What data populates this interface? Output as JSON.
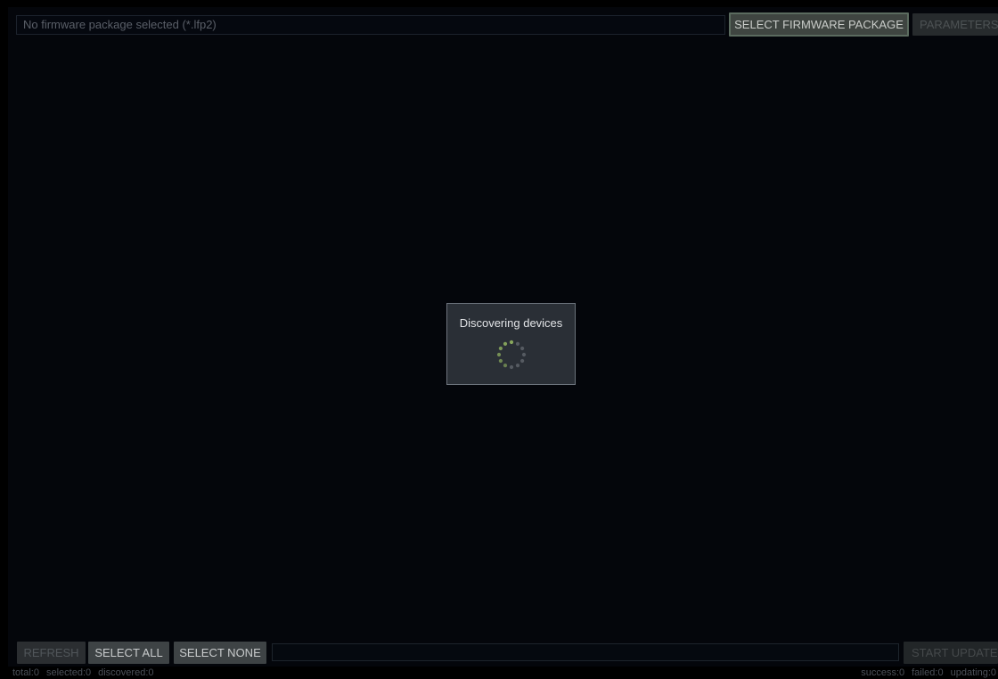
{
  "toolbar": {
    "firmware_field_text": "No firmware package selected (*.lfp2)",
    "select_firmware_label": "SELECT FIRMWARE PACKAGE",
    "parameters_label": "PARAMETERS"
  },
  "bottom_bar": {
    "refresh_label": "REFRESH",
    "select_all_label": "SELECT ALL",
    "select_none_label": "SELECT NONE",
    "start_update_label": "START UPDATE",
    "progress": 0
  },
  "status": {
    "total": "total:0",
    "selected": "selected:0",
    "discovered": "discovered:0",
    "success": "success:0",
    "failed": "failed:0",
    "updating": "updating:0"
  },
  "dialog": {
    "title": "Discovering devices",
    "spinner_icon": "loading-spinner-icon"
  },
  "colors": {
    "background": "#04060b",
    "spinner_active": "#a8d06a",
    "spinner_dim": "#5d6168",
    "accent_border": "#5b6b5f"
  }
}
